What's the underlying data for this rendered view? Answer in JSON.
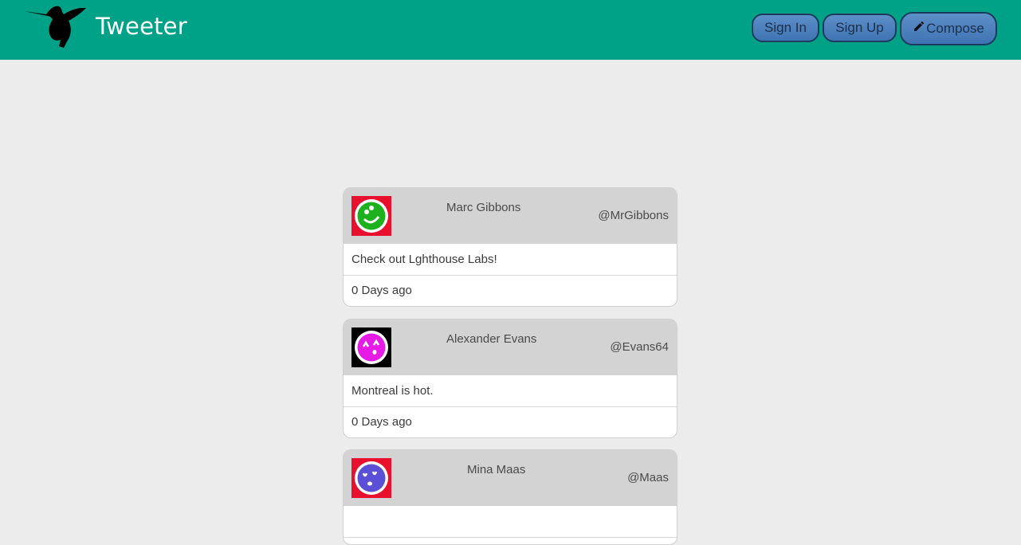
{
  "nav": {
    "brand": "Tweeter",
    "logo_icon": "hummingbird-icon",
    "signin_label": "Sign In",
    "signup_label": "Sign Up",
    "compose_label": "Compose",
    "compose_icon": "pencil-icon",
    "bg_color": "#00a287"
  },
  "tweets": [
    {
      "name": "Marc Gibbons",
      "handle": "@MrGibbons",
      "content": "Check out Lghthouse Labs!",
      "time": "0 Days ago",
      "avatar_bg": "#e8102d",
      "avatar_face": "#1db21d"
    },
    {
      "name": "Alexander Evans",
      "handle": "@Evans64",
      "content": "Montreal is hot.",
      "time": "0 Days ago",
      "avatar_bg": "#000000",
      "avatar_face": "#e61ce6"
    },
    {
      "name": "Mina Maas",
      "handle": "@Maas",
      "content": "",
      "time": "",
      "avatar_bg": "#e8102d",
      "avatar_face": "#5a4fd6"
    }
  ]
}
